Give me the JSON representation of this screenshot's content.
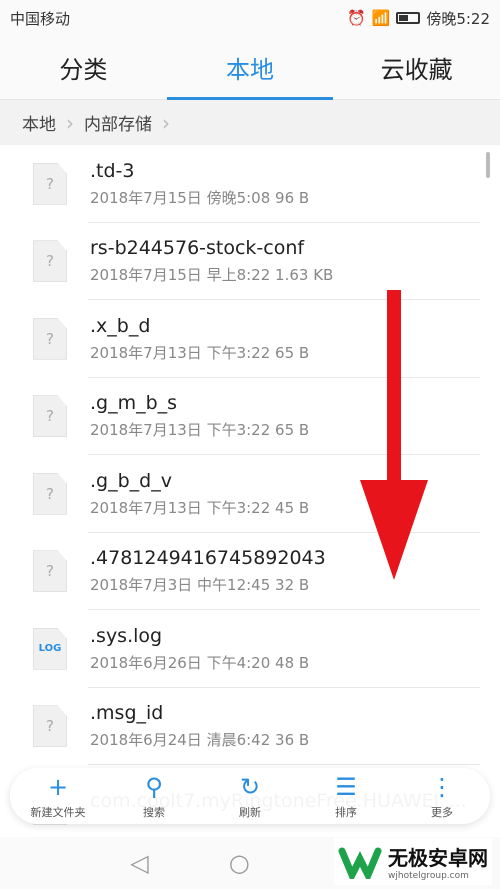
{
  "status": {
    "carrier": "中国移动",
    "time": "傍晚5:22",
    "network": "4G"
  },
  "tabs": [
    {
      "label": "分类"
    },
    {
      "label": "本地",
      "active": true
    },
    {
      "label": "云收藏"
    }
  ],
  "breadcrumb": [
    "本地",
    "内部存储"
  ],
  "files": [
    {
      "name": ".td-3",
      "meta": "2018年7月15日 傍晚5:08 96 B",
      "icon": "?"
    },
    {
      "name": "rs-b244576-stock-conf",
      "meta": "2018年7月15日 早上8:22 1.63 KB",
      "icon": "?"
    },
    {
      "name": ".x_b_d",
      "meta": "2018年7月13日 下午3:22 65 B",
      "icon": "?"
    },
    {
      "name": ".g_m_b_s",
      "meta": "2018年7月13日 下午3:22 65 B",
      "icon": "?"
    },
    {
      "name": ".g_b_d_v",
      "meta": "2018年7月13日 下午3:22 45 B",
      "icon": "?"
    },
    {
      "name": ".4781249416745892043",
      "meta": "2018年7月3日 中午12:45 32 B",
      "icon": "?"
    },
    {
      "name": ".sys.log",
      "meta": "2018年6月26日 下午4:20 48 B",
      "icon": "LOG"
    },
    {
      "name": ".msg_id",
      "meta": "2018年6月24日 清晨6:42 36 B",
      "icon": "?"
    },
    {
      "name": "com.coolt7.myRingtoneFree.HUAWEI_...",
      "meta": "",
      "icon": "?"
    }
  ],
  "toolbar": [
    {
      "label": "新建文件夹",
      "icon": "+"
    },
    {
      "label": "搜索",
      "icon": "⚲"
    },
    {
      "label": "刷新",
      "icon": "↻"
    },
    {
      "label": "排序",
      "icon": "☰"
    },
    {
      "label": "更多",
      "icon": "⋮"
    }
  ],
  "watermark": {
    "title": "无极安卓网",
    "url": "wjhotelgroup.com"
  },
  "colors": {
    "accent": "#2a8ee0",
    "arrow": "#e8141c"
  }
}
